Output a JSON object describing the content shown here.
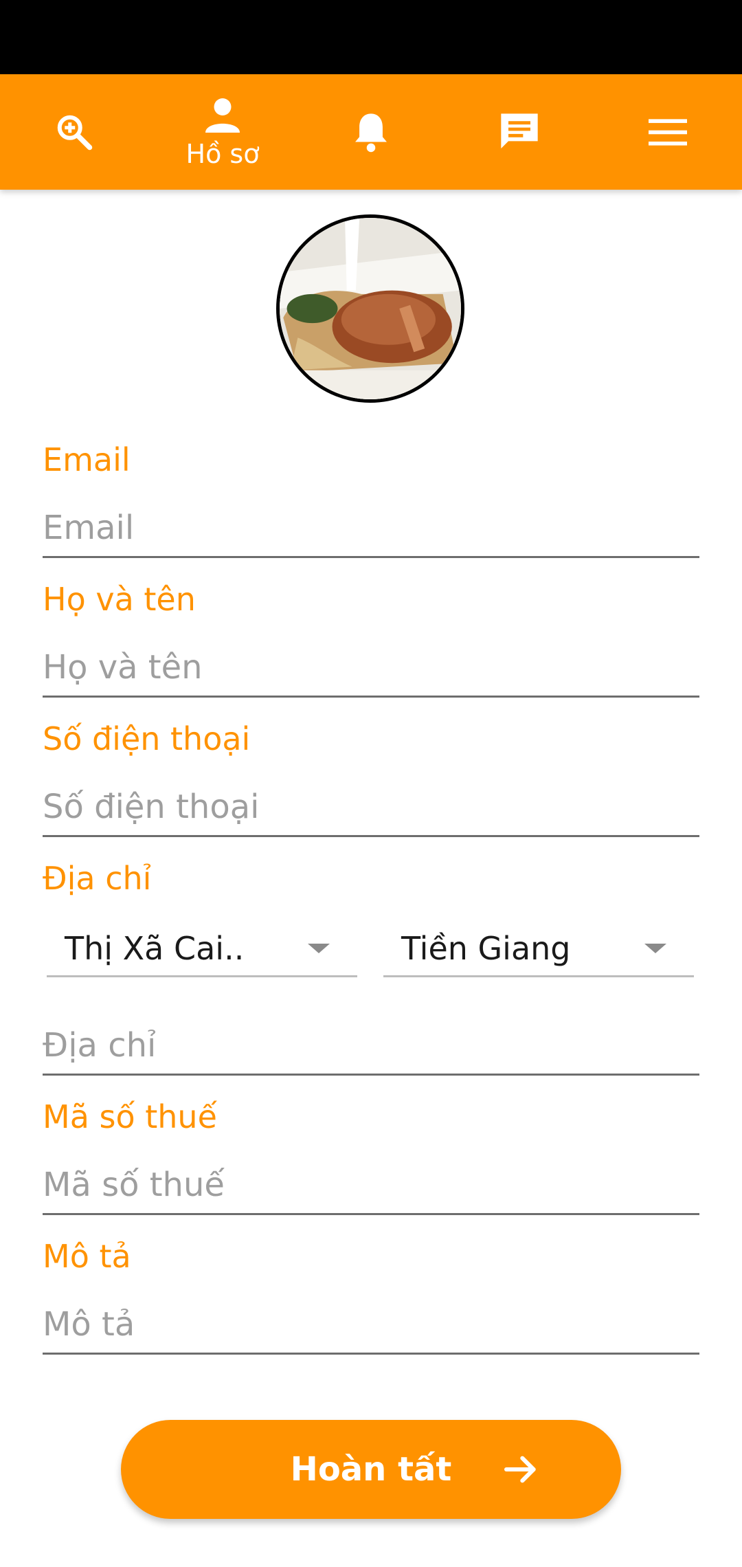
{
  "nav": {
    "items": [
      {
        "icon": "search-plus-icon",
        "label": ""
      },
      {
        "icon": "person-icon",
        "label": "Hồ sơ"
      },
      {
        "icon": "bell-icon",
        "label": ""
      },
      {
        "icon": "message-icon",
        "label": ""
      },
      {
        "icon": "menu-icon",
        "label": ""
      }
    ]
  },
  "avatar": {
    "alt": "food-photo"
  },
  "form": {
    "email": {
      "label": "Email",
      "placeholder": "Email"
    },
    "fullname": {
      "label": "Họ và tên",
      "placeholder": "Họ và tên"
    },
    "phone": {
      "label": "Số điện thoại",
      "placeholder": "Số điện thoại"
    },
    "address": {
      "label": "Địa chỉ",
      "district": "Thị Xã Cai..",
      "province": "Tiền Giang",
      "placeholder": "Địa chỉ"
    },
    "tax": {
      "label": "Mã số thuế",
      "placeholder": "Mã số thuế"
    },
    "description": {
      "label": "Mô tả",
      "placeholder": "Mô tả"
    }
  },
  "submit": {
    "label": "Hoàn tất",
    "icon": "arrow-right-icon"
  },
  "colors": {
    "accent": "#ff9200",
    "status_bar": "#000000"
  }
}
